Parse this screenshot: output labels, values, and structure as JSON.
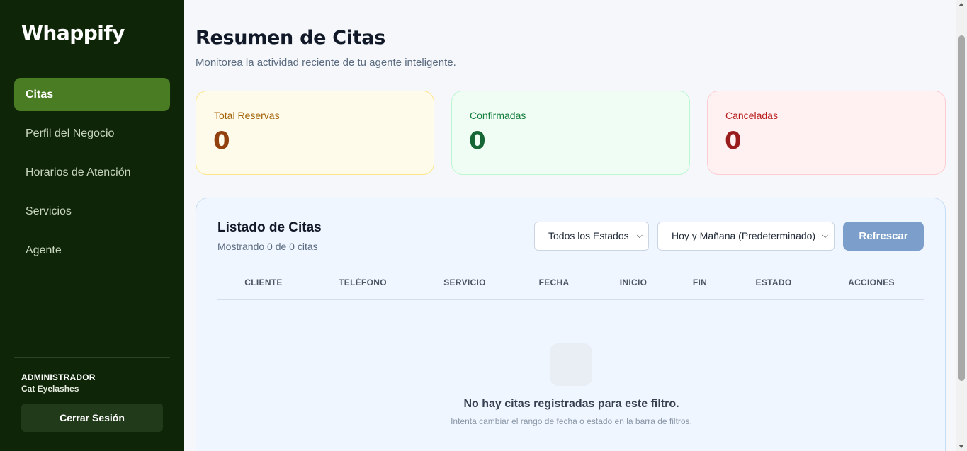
{
  "sidebar": {
    "logo": "Whappify",
    "items": [
      {
        "label": "Citas",
        "active": true
      },
      {
        "label": "Perfil del Negocio",
        "active": false
      },
      {
        "label": "Horarios de Atención",
        "active": false
      },
      {
        "label": "Servicios",
        "active": false
      },
      {
        "label": "Agente",
        "active": false
      }
    ],
    "user_role": "ADMINISTRADOR",
    "user_name": "Cat Eyelashes",
    "logout_label": "Cerrar Sesión"
  },
  "header": {
    "title": "Resumen de Citas",
    "subtitle": "Monitorea la actividad reciente de tu agente inteligente."
  },
  "stats": {
    "total": {
      "label": "Total Reservas",
      "value": "0"
    },
    "confirmed": {
      "label": "Confirmadas",
      "value": "0"
    },
    "cancelled": {
      "label": "Canceladas",
      "value": "0"
    }
  },
  "list": {
    "title": "Listado de Citas",
    "count_text": "Mostrando 0 de 0 citas",
    "status_filter": "Todos los Estados",
    "range_filter": "Hoy y Mañana (Predeterminado)",
    "refresh_label": "Refrescar",
    "columns": [
      "CLIENTE",
      "TELÉFONO",
      "SERVICIO",
      "FECHA",
      "INICIO",
      "FIN",
      "ESTADO",
      "ACCIONES"
    ],
    "empty_title": "No hay citas registradas para este filtro.",
    "empty_hint": "Intenta cambiar el rango de fecha o estado en la barra de filtros."
  },
  "colors": {
    "sidebar_bg": "#0e2508",
    "active_item": "#4a7c23",
    "refresh_button": "#7b9fca"
  }
}
